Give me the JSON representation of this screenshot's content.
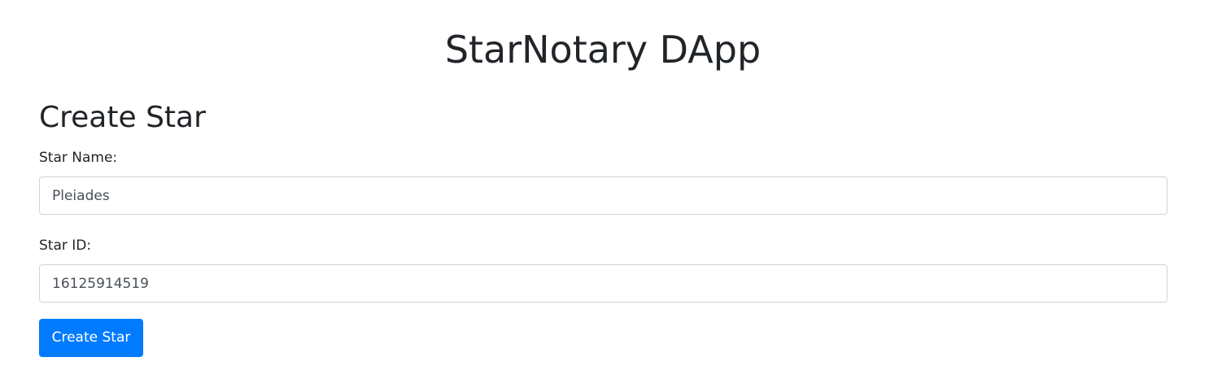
{
  "header": {
    "title": "StarNotary DApp"
  },
  "create_star": {
    "heading": "Create Star",
    "star_name": {
      "label": "Star Name:",
      "value": "Pleiades"
    },
    "star_id": {
      "label": "Star ID:",
      "value": "16125914519"
    },
    "submit_label": "Create Star"
  },
  "colors": {
    "primary_button": "#007bff",
    "text": "#212529",
    "input_border": "#ced4da"
  }
}
